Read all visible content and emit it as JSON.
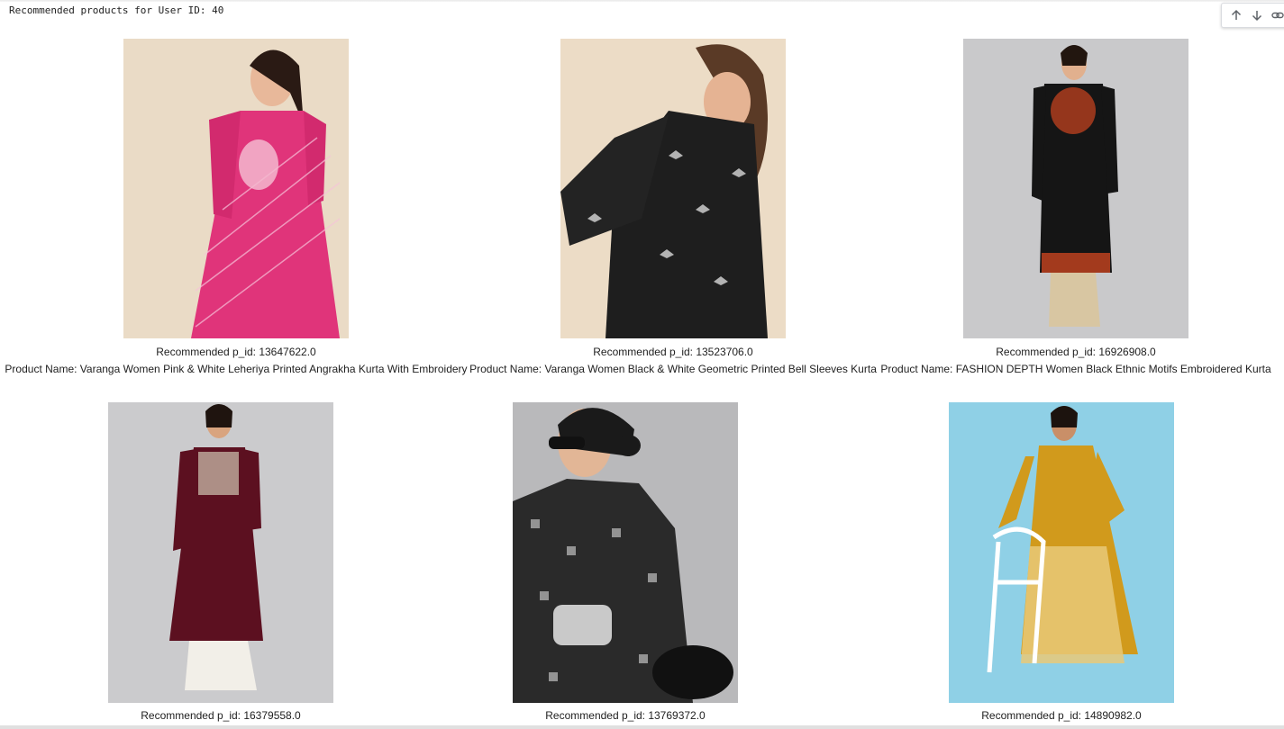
{
  "output": {
    "header": "Recommended products for User ID: 40"
  },
  "toolbar": {
    "icons": [
      "arrow-up-icon",
      "arrow-down-icon",
      "link-icon"
    ]
  },
  "products": [
    {
      "pid_text": "Recommended p_id: 13647622.0",
      "name_text": "Product Name: Varanga Women Pink & White Leheriya Printed Angrakha Kurta With Embroidery",
      "image_colors": {
        "background": "#eadbc6",
        "garment": "#e0347a"
      }
    },
    {
      "pid_text": "Recommended p_id: 13523706.0",
      "name_text": "Product Name: Varanga Women Black & White Geometric Printed Bell Sleeves Kurta",
      "image_colors": {
        "background": "#ecdcc6",
        "garment": "#1e1e1e"
      }
    },
    {
      "pid_text": "Recommended p_id: 16926908.0",
      "name_text": "Product Name: FASHION DEPTH Women Black Ethnic Motifs Embroidered Kurta",
      "image_colors": {
        "background": "#c9c9cb",
        "garment": "#151515"
      }
    },
    {
      "pid_text": "Recommended p_id: 16379558.0",
      "name_text": "",
      "image_colors": {
        "background": "#cbcbcd",
        "garment": "#5c1020"
      }
    },
    {
      "pid_text": "Recommended p_id: 13769372.0",
      "name_text": "",
      "image_colors": {
        "background": "#b9b9bb",
        "garment": "#2a2a2a"
      }
    },
    {
      "pid_text": "Recommended p_id: 14890982.0",
      "name_text": "",
      "image_colors": {
        "background": "#8fd0e6",
        "garment": "#d19a1c"
      }
    }
  ]
}
